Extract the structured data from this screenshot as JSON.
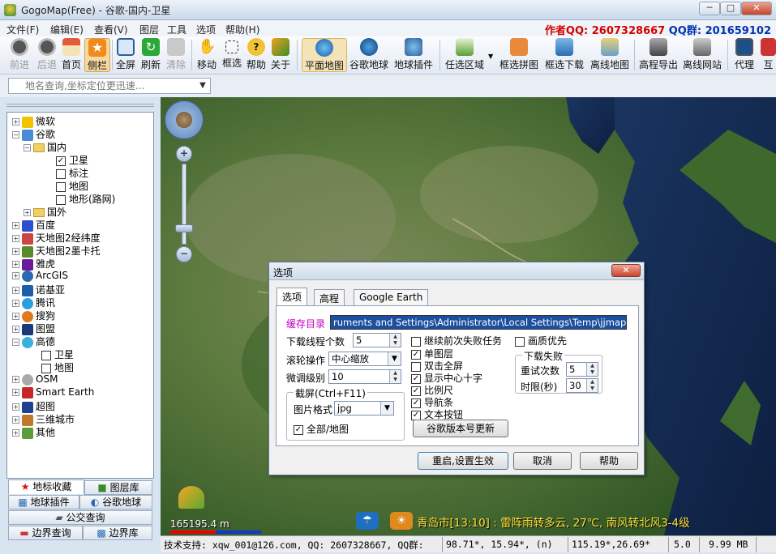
{
  "window": {
    "title": "GogoMap(Free) - 谷歌-国内-卫星",
    "min": "─",
    "max": "□",
    "close": "✕"
  },
  "menu": [
    "文件(F)",
    "编辑(E)",
    "查看(V)",
    "图层",
    "工具",
    "选项",
    "帮助(H)"
  ],
  "author": {
    "prefix": "作者QQ: 2607328667",
    "group": "QQ群: 201659102"
  },
  "toolbar": [
    "前进",
    "后退",
    "首页",
    "侧栏",
    "全屏",
    "刷新",
    "清除",
    "移动",
    "框选",
    "帮助",
    "关于",
    "平面地图",
    "谷歌地球",
    "地球插件",
    "任选区域",
    "框选拼图",
    "框选下载",
    "离线地图",
    "高程导出",
    "离线网站",
    "代理",
    "互"
  ],
  "search": {
    "placeholder": "地名查询,坐标定位更迅速...",
    "value": ""
  },
  "tree": [
    {
      "label": "微软"
    },
    {
      "label": "谷歌"
    },
    {
      "label": "国内"
    },
    {
      "label": "卫星"
    },
    {
      "label": "标注"
    },
    {
      "label": "地图"
    },
    {
      "label": "地形(路网)"
    },
    {
      "label": "国外"
    },
    {
      "label": "百度"
    },
    {
      "label": "天地图2经纬度"
    },
    {
      "label": "天地图2墨卡托"
    },
    {
      "label": "雅虎"
    },
    {
      "label": "ArcGIS"
    },
    {
      "label": "诺基亚"
    },
    {
      "label": "腾讯"
    },
    {
      "label": "搜狗"
    },
    {
      "label": "图盟"
    },
    {
      "label": "高德"
    },
    {
      "label": "卫星"
    },
    {
      "label": "地图"
    },
    {
      "label": "OSM"
    },
    {
      "label": "Smart Earth"
    },
    {
      "label": "超图"
    },
    {
      "label": "三维城市"
    },
    {
      "label": "其他"
    }
  ],
  "panel_tabs": [
    "地标收藏",
    "图层库",
    "地球插件",
    "谷歌地球",
    "公交查询",
    "边界查询",
    "边界库"
  ],
  "map": {
    "scale": "165195.4 m",
    "weather": "青岛市[13:10] : 雷阵雨转多云, 27℃, 南风转北风3-4级"
  },
  "status": {
    "support": "技术支持: xqw_001@126.com, QQ: 2607328667, QQ群:",
    "coord1": "98.71*, 15.94*, (n)",
    "coord2": "115.19*,26.69*",
    "zoom": "5.0",
    "mem": "9.99 MB"
  },
  "dialog": {
    "title": "选项",
    "close": "✕",
    "tabs": [
      "选项",
      "高程",
      "Google Earth"
    ],
    "cache_label": "缓存目录",
    "cache_path": "ruments and Settings\\Administrator\\Local Settings\\Temp\\jjmap\\",
    "threads_label": "下载线程个数",
    "threads": "5",
    "wheel_label": "滚轮操作",
    "wheel": "中心缩放",
    "fine_label": "微调级别",
    "fine": "10",
    "shot_group": "截屏(Ctrl+F11)",
    "format_label": "图片格式",
    "format": "jpg",
    "all_map": "全部/地图",
    "chk_continue": "继续前次失败任务",
    "chk_quality": "画质优先",
    "chk_single": "单图层",
    "chk_dbl": "双击全屏",
    "chk_cross": "显示中心十字",
    "chk_scale": "比例尺",
    "chk_nav": "导航条",
    "chk_textbtn": "文本按钮",
    "update_btn": "谷歌版本号更新",
    "fail_group": "下载失败",
    "retry_label": "重试次数",
    "retry": "5",
    "timeout_label": "时限(秒)",
    "timeout": "30",
    "apply": "重启,设置生效",
    "cancel": "取消",
    "help": "帮助"
  }
}
